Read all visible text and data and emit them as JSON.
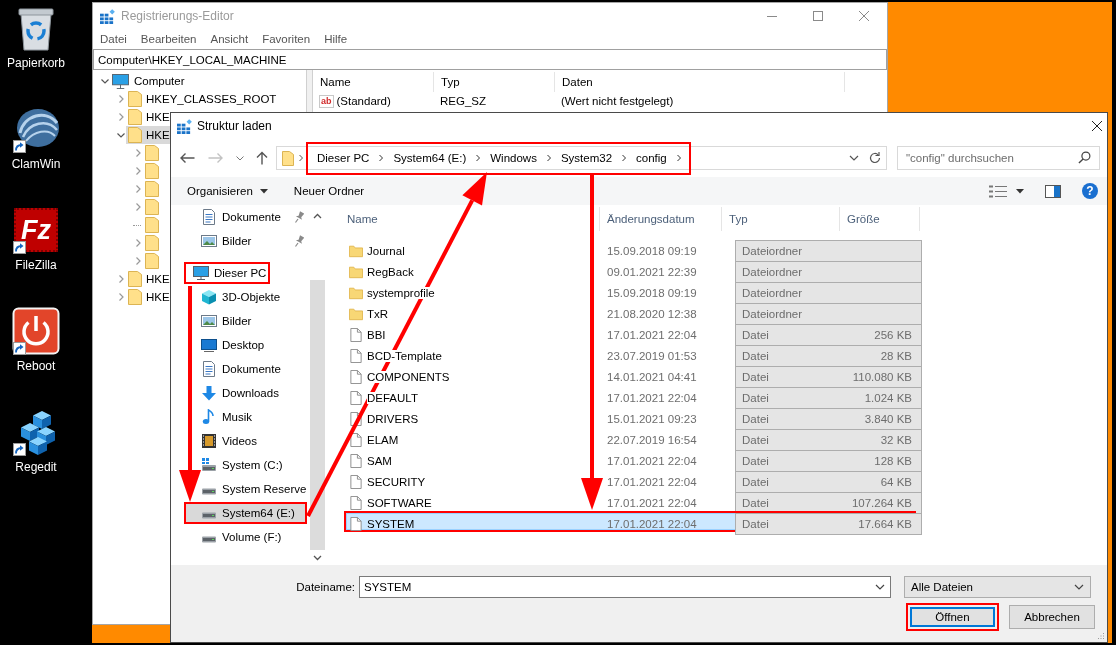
{
  "desktop_icons": [
    {
      "label": "Papierkorb",
      "kind": "bin",
      "shortcut": false
    },
    {
      "label": "ClamWin",
      "kind": "shell",
      "shortcut": true
    },
    {
      "label": "FileZilla",
      "kind": "logo",
      "logo_text": "Fz",
      "shortcut": true
    },
    {
      "label": "Reboot",
      "kind": "power",
      "shortcut": true
    },
    {
      "label": "Regedit",
      "kind": "cubes",
      "shortcut": true
    }
  ],
  "registry_editor": {
    "title": "Registrierungs-Editor",
    "menu": [
      "Datei",
      "Bearbeiten",
      "Ansicht",
      "Favoriten",
      "Hilfe"
    ],
    "address": "Computer\\HKEY_LOCAL_MACHINE",
    "tree": [
      {
        "label": "Computer",
        "kind": "computer",
        "expanded": true,
        "selected": false,
        "children": [
          {
            "label": "HKEY_CLASSES_ROOT",
            "kind": "folder",
            "expanded": false,
            "selected": false
          },
          {
            "label": "HKE",
            "kind": "folder",
            "expanded": false,
            "selected": false
          },
          {
            "label": "HKE",
            "kind": "folder",
            "expanded": true,
            "selected": true,
            "children": [
              {
                "expandable": true
              },
              {
                "expandable": true
              },
              {
                "expandable": true
              },
              {
                "expandable": true
              },
              {
                "expandable": false
              },
              {
                "expandable": true
              },
              {
                "expandable": true
              }
            ]
          },
          {
            "label": "HKE",
            "kind": "folder",
            "expanded": false,
            "selected": false
          },
          {
            "label": "HKE",
            "kind": "folder",
            "expanded": false,
            "selected": false
          }
        ]
      }
    ],
    "values": {
      "columns": [
        "Name",
        "Typ",
        "Daten"
      ],
      "rows": [
        {
          "icon_text": "ab",
          "name": "(Standard)",
          "type": "REG_SZ",
          "data": "(Wert nicht festgelegt)"
        }
      ]
    }
  },
  "dialog": {
    "title": "Struktur laden",
    "address": {
      "segments": [
        "Dieser PC",
        "System64 (E:)",
        "Windows",
        "System32",
        "config"
      ],
      "highlighted": true
    },
    "search": {
      "placeholder": "\"config\" durchsuchen"
    },
    "toolbar": [
      {
        "label": "Organisieren",
        "kind": "menu"
      },
      {
        "label": "Neuer Ordner",
        "kind": "button"
      }
    ],
    "help_button": "?",
    "nav_pane": {
      "pinned_items": [
        {
          "label": "Dokumente",
          "kind": "documents",
          "pinned": true,
          "selected": false,
          "highlighted": false
        },
        {
          "label": "Bilder",
          "kind": "pictures",
          "pinned": true,
          "selected": false,
          "highlighted": false
        }
      ],
      "tree": [
        {
          "label": "Dieser PC",
          "kind": "pc",
          "selected": false,
          "highlighted": true,
          "children": [
            {
              "label": "3D-Objekte",
              "kind": "objects",
              "selected": false,
              "highlighted": false
            },
            {
              "label": "Bilder",
              "kind": "pictures",
              "selected": false,
              "highlighted": false
            },
            {
              "label": "Desktop",
              "kind": "desktop",
              "selected": false,
              "highlighted": false
            },
            {
              "label": "Dokumente",
              "kind": "documents",
              "selected": false,
              "highlighted": false
            },
            {
              "label": "Downloads",
              "kind": "downloads",
              "selected": false,
              "highlighted": false
            },
            {
              "label": "Musik",
              "kind": "music",
              "selected": false,
              "highlighted": false
            },
            {
              "label": "Videos",
              "kind": "videos",
              "selected": false,
              "highlighted": false
            },
            {
              "label": "System (C:)",
              "kind": "system",
              "selected": false,
              "highlighted": false
            },
            {
              "label": "System Reserve",
              "kind": "drive",
              "selected": false,
              "highlighted": false
            },
            {
              "label": "System64 (E:)",
              "kind": "drive",
              "selected": true,
              "highlighted": true
            },
            {
              "label": "Volume (F:)",
              "kind": "drive",
              "selected": false,
              "highlighted": false
            }
          ]
        }
      ]
    },
    "file_list": {
      "columns": [
        "Name",
        "Änderungsdatum",
        "Typ",
        "Größe"
      ],
      "rows": [
        {
          "name": "Journal",
          "kind": "folder",
          "date": "15.09.2018 09:19",
          "type": "Dateiordner",
          "selected": false,
          "highlighted": false
        },
        {
          "name": "RegBack",
          "kind": "folder",
          "date": "09.01.2021 22:39",
          "type": "Dateiordner",
          "selected": false,
          "highlighted": false
        },
        {
          "name": "systemprofile",
          "kind": "folder",
          "date": "15.09.2018 09:19",
          "type": "Dateiordner",
          "selected": false,
          "highlighted": false
        },
        {
          "name": "TxR",
          "kind": "folder",
          "date": "21.08.2020 12:38",
          "type": "Dateiordner",
          "selected": false,
          "highlighted": false
        },
        {
          "name": "BBI",
          "kind": "file",
          "date": "17.01.2021 22:04",
          "type": "Datei",
          "size": "256 KB",
          "selected": false,
          "highlighted": false
        },
        {
          "name": "BCD-Template",
          "kind": "file",
          "date": "23.07.2019 01:53",
          "type": "Datei",
          "size": "28 KB",
          "selected": false,
          "highlighted": false
        },
        {
          "name": "COMPONENTS",
          "kind": "file",
          "date": "14.01.2021 04:41",
          "type": "Datei",
          "size": "110.080 KB",
          "selected": false,
          "highlighted": false
        },
        {
          "name": "DEFAULT",
          "kind": "file",
          "date": "17.01.2021 22:04",
          "type": "Datei",
          "size": "1.024 KB",
          "selected": false,
          "highlighted": false
        },
        {
          "name": "DRIVERS",
          "kind": "file",
          "date": "15.01.2021 09:23",
          "type": "Datei",
          "size": "3.840 KB",
          "selected": false,
          "highlighted": false
        },
        {
          "name": "ELAM",
          "kind": "file",
          "date": "22.07.2019 16:54",
          "type": "Datei",
          "size": "32 KB",
          "selected": false,
          "highlighted": false
        },
        {
          "name": "SAM",
          "kind": "file",
          "date": "17.01.2021 22:04",
          "type": "Datei",
          "size": "128 KB",
          "selected": false,
          "highlighted": false
        },
        {
          "name": "SECURITY",
          "kind": "file",
          "date": "17.01.2021 22:04",
          "type": "Datei",
          "size": "64 KB",
          "selected": false,
          "highlighted": false
        },
        {
          "name": "SOFTWARE",
          "kind": "file",
          "date": "17.01.2021 22:04",
          "type": "Datei",
          "size": "107.264 KB",
          "selected": false,
          "highlighted": false
        },
        {
          "name": "SYSTEM",
          "kind": "file",
          "date": "17.01.2021 22:04",
          "type": "Datei",
          "size": "17.664 KB",
          "selected": true,
          "highlighted": true
        }
      ]
    },
    "file_name": {
      "label": "Dateiname:",
      "value": "SYSTEM"
    },
    "file_type": {
      "value": "Alle Dateien"
    },
    "buttons": [
      {
        "label": "Öffnen",
        "default": true,
        "highlighted": true
      },
      {
        "label": "Abbrechen",
        "default": false,
        "highlighted": false
      }
    ]
  }
}
